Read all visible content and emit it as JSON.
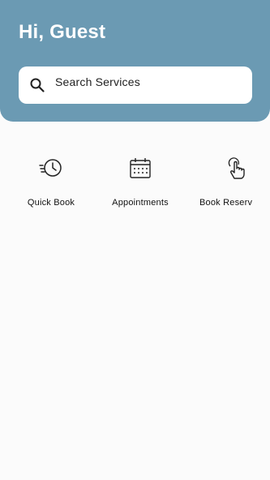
{
  "header": {
    "greeting": "Hi, Guest",
    "background_color": "#6b9ab3"
  },
  "search": {
    "placeholder": "Search Services",
    "icon": "search-icon"
  },
  "quick_actions": [
    {
      "label": "Quick Book",
      "icon": "clock-icon"
    },
    {
      "label": "Appointments",
      "icon": "calendar-icon"
    },
    {
      "label": "Book Reserv",
      "icon": "tap-hand-icon"
    }
  ]
}
